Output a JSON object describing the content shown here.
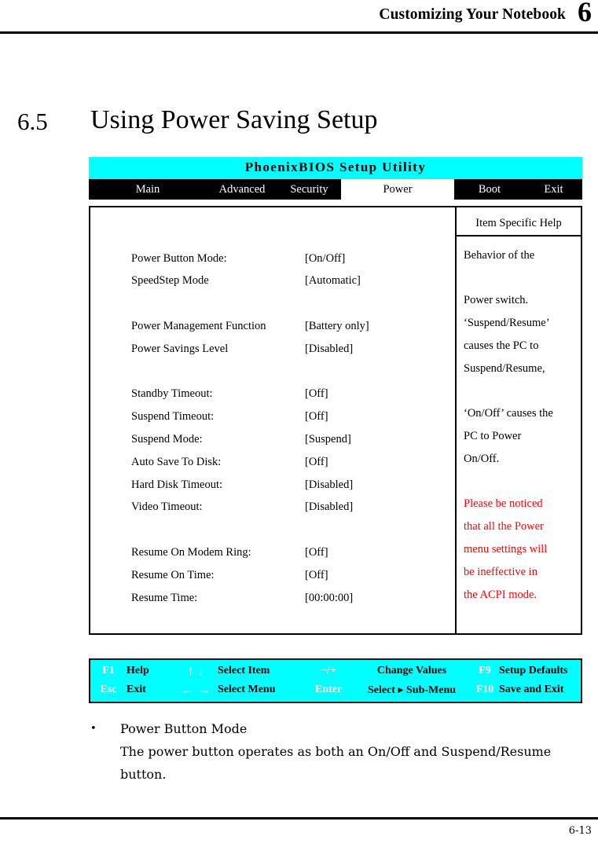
{
  "page": {
    "header_text": "Customizing Your Notebook",
    "chapter_number": "6",
    "section_number": "6.5",
    "section_title": "Using Power Saving Setup",
    "page_number": "6-13"
  },
  "bios": {
    "title": "PhoenixBIOS Setup Utility",
    "tabs": [
      {
        "label": "Main",
        "selected": false
      },
      {
        "label": "Advanced",
        "selected": false
      },
      {
        "label": "Security",
        "selected": false
      },
      {
        "label": "Power",
        "selected": true
      },
      {
        "label": "Boot",
        "selected": false
      },
      {
        "label": "Exit",
        "selected": false
      }
    ],
    "settings": [
      {
        "label": "Power Button Mode:",
        "value": "[On/Off]"
      },
      {
        "label": "SpeedStep Mode",
        "value": "[Automatic]"
      },
      {
        "label": "",
        "value": ""
      },
      {
        "label": "Power Management Function",
        "value": "[Battery only]"
      },
      {
        "label": "Power Savings Level",
        "value": "[Disabled]"
      },
      {
        "label": "",
        "value": ""
      },
      {
        "label": "Standby Timeout:",
        "value": "[Off]"
      },
      {
        "label": "Suspend Timeout:",
        "value": "[Off]"
      },
      {
        "label": "Suspend Mode:",
        "value": "[Suspend]"
      },
      {
        "label": "Auto Save To Disk:",
        "value": "[Off]"
      },
      {
        "label": "Hard Disk Timeout:",
        "value": "[Disabled]"
      },
      {
        "label": "Video Timeout:",
        "value": "[Disabled]"
      },
      {
        "label": "",
        "value": ""
      },
      {
        "label": "Resume On Modem Ring:",
        "value": "[Off]"
      },
      {
        "label": "Resume On Time:",
        "value": "[Off]"
      },
      {
        "label": "Resume Time:",
        "value": "[00:00:00]"
      }
    ],
    "help": {
      "title": "Item Specific Help",
      "lines": [
        {
          "text": "Behavior of the",
          "red": false
        },
        {
          "text": "",
          "red": false
        },
        {
          "text": "Power switch.",
          "red": false
        },
        {
          "text": "‘Suspend/Resume’",
          "red": false
        },
        {
          "text": "causes the PC to",
          "red": false
        },
        {
          "text": "Suspend/Resume,",
          "red": false
        },
        {
          "text": "",
          "red": false
        },
        {
          "text": "‘On/Off’ causes the",
          "red": false
        },
        {
          "text": "PC to Power",
          "red": false
        },
        {
          "text": "On/Off.",
          "red": false
        },
        {
          "text": "",
          "red": false
        },
        {
          "text": "Please be noticed",
          "red": true
        },
        {
          "text": "that all the Power",
          "red": true
        },
        {
          "text": "menu settings will",
          "red": true
        },
        {
          "text": "be ineffective in",
          "red": true
        },
        {
          "text": "the ACPI mode.",
          "red": true
        }
      ]
    },
    "keybar": {
      "row1": {
        "key1": "F1",
        "desc1": "Help",
        "arrows": "↑ ↓",
        "desc2": "Select Item",
        "key2": "−/+",
        "desc3": "Change Values",
        "key3": "F9",
        "desc4": "Setup Defaults"
      },
      "row2": {
        "key1": "Esc",
        "desc1": "Exit",
        "arrows": "← →",
        "desc2": "Select Menu",
        "key2": "Enter",
        "desc3": "Select ▸ Sub-Menu",
        "key3": "F10",
        "desc4": "Save and Exit"
      }
    },
    "colors": {
      "title_bar": "#00ffff",
      "menu_bar": "#000000",
      "warning_text": "#ff0000"
    }
  },
  "body_text": {
    "bullet_glyph": "•",
    "bullet_heading": "Power Button Mode",
    "bullet_body": "The power button operates as both an On/Off and Suspend/Resume button."
  }
}
